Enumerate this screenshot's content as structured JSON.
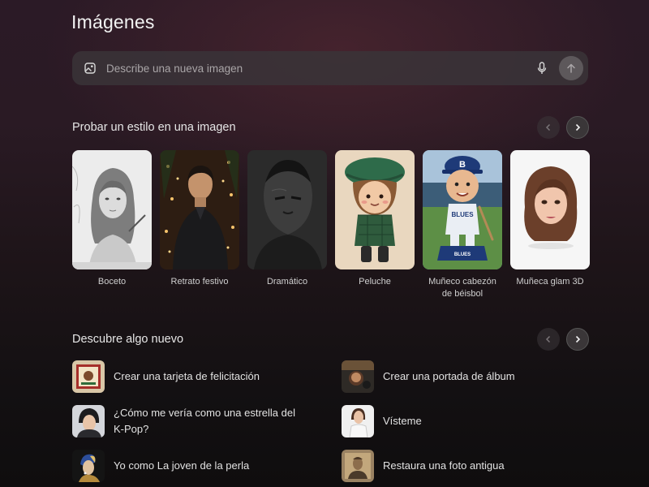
{
  "page": {
    "title": "Imágenes"
  },
  "prompt": {
    "placeholder": "Describe una nueva imagen",
    "icons": [
      "image-icon",
      "microphone-icon",
      "arrow-up-icon"
    ]
  },
  "styles_section": {
    "title": "Probar un estilo en una imagen",
    "items": [
      {
        "label": "Boceto",
        "icon": "sketch-portrait"
      },
      {
        "label": "Retrato festivo",
        "icon": "festive-portrait"
      },
      {
        "label": "Dramático",
        "icon": "dramatic-portrait"
      },
      {
        "label": "Peluche",
        "icon": "plush-doll"
      },
      {
        "label": "Muñeco cabezón de béisbol",
        "icon": "baseball-bobblehead"
      },
      {
        "label": "Muñeca glam 3D",
        "icon": "glam-doll"
      }
    ]
  },
  "discover_section": {
    "title": "Descubre algo nuevo",
    "items": [
      {
        "label": "Crear una tarjeta de felicitación",
        "icon": "greeting-card"
      },
      {
        "label": "Crear una portada de álbum",
        "icon": "album-cover"
      },
      {
        "label": "¿Cómo me vería como una estrella del K-Pop?",
        "icon": "kpop-star"
      },
      {
        "label": "Vísteme",
        "icon": "dress-me"
      },
      {
        "label": "Yo como La joven de la perla",
        "icon": "pearl-earring"
      },
      {
        "label": "Restaura una foto antigua",
        "icon": "old-photo"
      }
    ]
  },
  "colors": {
    "accent_button": "#5d585b",
    "background_top": "#2b1a26",
    "background_bottom": "#0f0d0e"
  }
}
